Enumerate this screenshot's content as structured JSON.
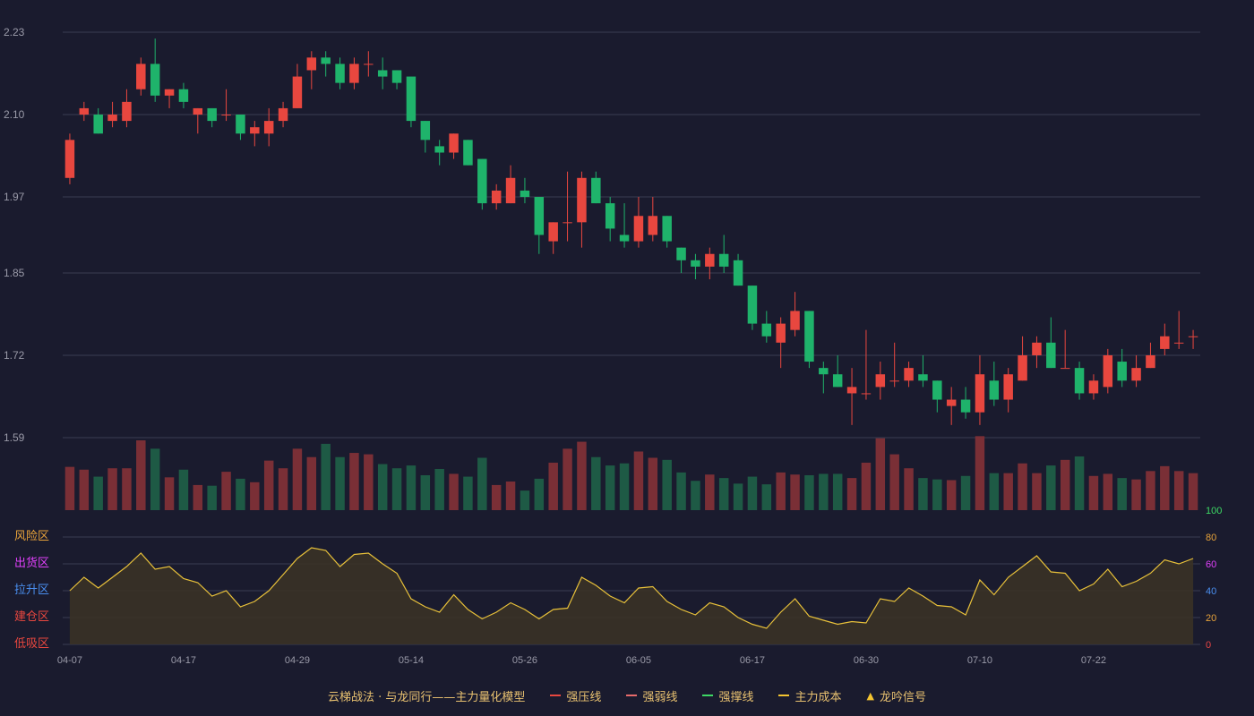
{
  "colors": {
    "background": "#1a1b2e",
    "grid": "#3a3c52",
    "up": "#e8473f",
    "down": "#1fb36b",
    "vol_up": "#7a2f36",
    "vol_down": "#1e5a45",
    "axis_text": "#9a9aa8",
    "osc_line": "#e8c13a",
    "osc_fill": "#3a3226"
  },
  "chart_data": {
    "type": "candlestick",
    "price_axis": {
      "ticks": [
        "2.23",
        "2.10",
        "1.97",
        "1.85",
        "1.72",
        "1.59"
      ],
      "range": [
        1.59,
        2.23
      ]
    },
    "x_labels": [
      "04-07",
      "04-17",
      "04-29",
      "05-14",
      "05-26",
      "06-05",
      "06-17",
      "06-30",
      "07-10",
      "07-22"
    ],
    "x_label_index": [
      0,
      8,
      16,
      24,
      32,
      40,
      48,
      56,
      64,
      72
    ],
    "candles": [
      {
        "o": 2.0,
        "c": 2.06,
        "h": 2.07,
        "l": 1.99
      },
      {
        "o": 2.1,
        "c": 2.11,
        "h": 2.12,
        "l": 2.09
      },
      {
        "o": 2.1,
        "c": 2.07,
        "h": 2.11,
        "l": 2.07
      },
      {
        "o": 2.09,
        "c": 2.1,
        "h": 2.12,
        "l": 2.08
      },
      {
        "o": 2.09,
        "c": 2.12,
        "h": 2.14,
        "l": 2.08
      },
      {
        "o": 2.14,
        "c": 2.18,
        "h": 2.19,
        "l": 2.13
      },
      {
        "o": 2.18,
        "c": 2.13,
        "h": 2.22,
        "l": 2.12
      },
      {
        "o": 2.13,
        "c": 2.14,
        "h": 2.14,
        "l": 2.11
      },
      {
        "o": 2.14,
        "c": 2.12,
        "h": 2.15,
        "l": 2.11
      },
      {
        "o": 2.1,
        "c": 2.11,
        "h": 2.11,
        "l": 2.07
      },
      {
        "o": 2.11,
        "c": 2.09,
        "h": 2.11,
        "l": 2.08
      },
      {
        "o": 2.1,
        "c": 2.1,
        "h": 2.14,
        "l": 2.09
      },
      {
        "o": 2.1,
        "c": 2.07,
        "h": 2.1,
        "l": 2.06
      },
      {
        "o": 2.07,
        "c": 2.08,
        "h": 2.09,
        "l": 2.05
      },
      {
        "o": 2.07,
        "c": 2.09,
        "h": 2.11,
        "l": 2.05
      },
      {
        "o": 2.09,
        "c": 2.11,
        "h": 2.12,
        "l": 2.08
      },
      {
        "o": 2.11,
        "c": 2.16,
        "h": 2.18,
        "l": 2.11
      },
      {
        "o": 2.17,
        "c": 2.19,
        "h": 2.2,
        "l": 2.14
      },
      {
        "o": 2.19,
        "c": 2.18,
        "h": 2.2,
        "l": 2.16
      },
      {
        "o": 2.18,
        "c": 2.15,
        "h": 2.19,
        "l": 2.14
      },
      {
        "o": 2.15,
        "c": 2.18,
        "h": 2.19,
        "l": 2.14
      },
      {
        "o": 2.18,
        "c": 2.18,
        "h": 2.2,
        "l": 2.16
      },
      {
        "o": 2.17,
        "c": 2.16,
        "h": 2.19,
        "l": 2.14
      },
      {
        "o": 2.17,
        "c": 2.15,
        "h": 2.17,
        "l": 2.14
      },
      {
        "o": 2.16,
        "c": 2.09,
        "h": 2.16,
        "l": 2.08
      },
      {
        "o": 2.09,
        "c": 2.06,
        "h": 2.09,
        "l": 2.04
      },
      {
        "o": 2.05,
        "c": 2.04,
        "h": 2.06,
        "l": 2.02
      },
      {
        "o": 2.04,
        "c": 2.07,
        "h": 2.07,
        "l": 2.03
      },
      {
        "o": 2.06,
        "c": 2.02,
        "h": 2.06,
        "l": 2.02
      },
      {
        "o": 2.03,
        "c": 1.96,
        "h": 2.03,
        "l": 1.95
      },
      {
        "o": 1.96,
        "c": 1.98,
        "h": 1.99,
        "l": 1.95
      },
      {
        "o": 1.96,
        "c": 2.0,
        "h": 2.02,
        "l": 1.96
      },
      {
        "o": 1.98,
        "c": 1.97,
        "h": 2.0,
        "l": 1.96
      },
      {
        "o": 1.97,
        "c": 1.91,
        "h": 1.97,
        "l": 1.88
      },
      {
        "o": 1.9,
        "c": 1.93,
        "h": 1.93,
        "l": 1.88
      },
      {
        "o": 1.93,
        "c": 1.93,
        "h": 2.01,
        "l": 1.9
      },
      {
        "o": 1.93,
        "c": 2.0,
        "h": 2.01,
        "l": 1.89
      },
      {
        "o": 2.0,
        "c": 1.96,
        "h": 2.01,
        "l": 1.96
      },
      {
        "o": 1.96,
        "c": 1.92,
        "h": 1.97,
        "l": 1.9
      },
      {
        "o": 1.91,
        "c": 1.9,
        "h": 1.96,
        "l": 1.89
      },
      {
        "o": 1.9,
        "c": 1.94,
        "h": 1.97,
        "l": 1.89
      },
      {
        "o": 1.91,
        "c": 1.94,
        "h": 1.97,
        "l": 1.9
      },
      {
        "o": 1.94,
        "c": 1.9,
        "h": 1.94,
        "l": 1.89
      },
      {
        "o": 1.89,
        "c": 1.87,
        "h": 1.89,
        "l": 1.85
      },
      {
        "o": 1.87,
        "c": 1.86,
        "h": 1.88,
        "l": 1.84
      },
      {
        "o": 1.86,
        "c": 1.88,
        "h": 1.89,
        "l": 1.84
      },
      {
        "o": 1.88,
        "c": 1.86,
        "h": 1.91,
        "l": 1.85
      },
      {
        "o": 1.87,
        "c": 1.83,
        "h": 1.88,
        "l": 1.83
      },
      {
        "o": 1.83,
        "c": 1.77,
        "h": 1.83,
        "l": 1.76
      },
      {
        "o": 1.77,
        "c": 1.75,
        "h": 1.79,
        "l": 1.74
      },
      {
        "o": 1.74,
        "c": 1.77,
        "h": 1.78,
        "l": 1.7
      },
      {
        "o": 1.76,
        "c": 1.79,
        "h": 1.82,
        "l": 1.75
      },
      {
        "o": 1.79,
        "c": 1.71,
        "h": 1.79,
        "l": 1.7
      },
      {
        "o": 1.7,
        "c": 1.69,
        "h": 1.71,
        "l": 1.66
      },
      {
        "o": 1.69,
        "c": 1.67,
        "h": 1.72,
        "l": 1.67
      },
      {
        "o": 1.66,
        "c": 1.67,
        "h": 1.7,
        "l": 1.61
      },
      {
        "o": 1.66,
        "c": 1.66,
        "h": 1.76,
        "l": 1.65
      },
      {
        "o": 1.67,
        "c": 1.69,
        "h": 1.71,
        "l": 1.65
      },
      {
        "o": 1.68,
        "c": 1.68,
        "h": 1.74,
        "l": 1.67
      },
      {
        "o": 1.68,
        "c": 1.7,
        "h": 1.71,
        "l": 1.67
      },
      {
        "o": 1.69,
        "c": 1.68,
        "h": 1.72,
        "l": 1.67
      },
      {
        "o": 1.68,
        "c": 1.65,
        "h": 1.68,
        "l": 1.63
      },
      {
        "o": 1.64,
        "c": 1.65,
        "h": 1.67,
        "l": 1.61
      },
      {
        "o": 1.65,
        "c": 1.63,
        "h": 1.67,
        "l": 1.62
      },
      {
        "o": 1.63,
        "c": 1.69,
        "h": 1.72,
        "l": 1.61
      },
      {
        "o": 1.68,
        "c": 1.65,
        "h": 1.71,
        "l": 1.64
      },
      {
        "o": 1.65,
        "c": 1.69,
        "h": 1.7,
        "l": 1.63
      },
      {
        "o": 1.68,
        "c": 1.72,
        "h": 1.75,
        "l": 1.68
      },
      {
        "o": 1.72,
        "c": 1.74,
        "h": 1.75,
        "l": 1.7
      },
      {
        "o": 1.74,
        "c": 1.7,
        "h": 1.78,
        "l": 1.7
      },
      {
        "o": 1.7,
        "c": 1.7,
        "h": 1.76,
        "l": 1.7
      },
      {
        "o": 1.7,
        "c": 1.66,
        "h": 1.71,
        "l": 1.65
      },
      {
        "o": 1.66,
        "c": 1.68,
        "h": 1.69,
        "l": 1.65
      },
      {
        "o": 1.67,
        "c": 1.72,
        "h": 1.73,
        "l": 1.66
      },
      {
        "o": 1.71,
        "c": 1.68,
        "h": 1.73,
        "l": 1.67
      },
      {
        "o": 1.68,
        "c": 1.7,
        "h": 1.72,
        "l": 1.67
      },
      {
        "o": 1.7,
        "c": 1.72,
        "h": 1.74,
        "l": 1.7
      },
      {
        "o": 1.73,
        "c": 1.75,
        "h": 1.77,
        "l": 1.72
      },
      {
        "o": 1.74,
        "c": 1.74,
        "h": 1.79,
        "l": 1.73
      },
      {
        "o": 1.75,
        "c": 1.75,
        "h": 1.76,
        "l": 1.73
      }
    ],
    "volume": [
      0.62,
      0.58,
      0.48,
      0.6,
      0.6,
      1.0,
      0.88,
      0.47,
      0.58,
      0.36,
      0.35,
      0.55,
      0.45,
      0.4,
      0.71,
      0.6,
      0.88,
      0.76,
      0.95,
      0.76,
      0.82,
      0.8,
      0.66,
      0.6,
      0.64,
      0.5,
      0.59,
      0.52,
      0.48,
      0.75,
      0.36,
      0.41,
      0.28,
      0.45,
      0.68,
      0.88,
      0.98,
      0.76,
      0.64,
      0.67,
      0.84,
      0.75,
      0.72,
      0.54,
      0.42,
      0.51,
      0.46,
      0.38,
      0.48,
      0.37,
      0.54,
      0.51,
      0.5,
      0.52,
      0.52,
      0.46,
      0.68,
      1.03,
      0.8,
      0.6,
      0.46,
      0.44,
      0.43,
      0.49,
      1.06,
      0.53,
      0.53,
      0.67,
      0.53,
      0.64,
      0.72,
      0.77,
      0.49,
      0.52,
      0.46,
      0.44,
      0.56,
      0.63,
      0.56,
      0.53
    ],
    "oscillator": {
      "axis_ticks": [
        "100",
        "80",
        "60",
        "40",
        "20",
        "0"
      ],
      "axis_tick_colors": [
        "#3dd864",
        "#e8a33a",
        "#e040fb",
        "#4a8ff0",
        "#e8a33a",
        "#e84545"
      ],
      "zones": [
        "风险区",
        "出货区",
        "拉升区",
        "建仓区",
        "低吸区"
      ],
      "zone_colors": [
        "#e8a33a",
        "#e040fb",
        "#4a8ff0",
        "#e8473f",
        "#e8473f"
      ],
      "range": [
        0,
        100
      ],
      "values": [
        40,
        50,
        42,
        50,
        58,
        68,
        56,
        58,
        49,
        46,
        36,
        40,
        28,
        32,
        40,
        52,
        64,
        72,
        70,
        58,
        67,
        68,
        60,
        53,
        34,
        28,
        24,
        37,
        26,
        19,
        24,
        31,
        26,
        19,
        26,
        27,
        50,
        44,
        36,
        31,
        42,
        43,
        32,
        26,
        22,
        31,
        28,
        20,
        15,
        12,
        24,
        34,
        21,
        18,
        15,
        17,
        16,
        34,
        32,
        42,
        36,
        29,
        28,
        22,
        48,
        37,
        50,
        58,
        66,
        54,
        53,
        40,
        45,
        56,
        43,
        47,
        53,
        63,
        60,
        64
      ]
    }
  },
  "legend": {
    "title": "云梯战法 · 与龙同行——主力量化模型",
    "items": [
      {
        "label": "强压线",
        "color": "#e8473f",
        "style": "solid"
      },
      {
        "label": "强弱线",
        "color": "#e86b6b",
        "style": "dashed"
      },
      {
        "label": "强撑线",
        "color": "#3dd864",
        "style": "solid"
      },
      {
        "label": "主力成本",
        "color": "#f4c430",
        "style": "dashed"
      },
      {
        "label": "龙吟信号",
        "color": "#f4c430",
        "style": "triangle"
      }
    ]
  }
}
